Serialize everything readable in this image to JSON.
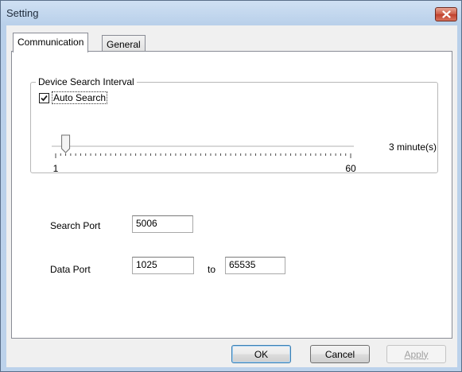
{
  "window": {
    "title": "Setting"
  },
  "tabs": [
    {
      "label": "Communication",
      "active": true
    },
    {
      "label": "General",
      "active": false
    }
  ],
  "device_search": {
    "group_label": "Device Search Interval",
    "auto_search_label": "Auto Search",
    "auto_search_checked": true,
    "slider": {
      "min_label": "1",
      "max_label": "60",
      "min": 1,
      "max": 60,
      "value": 3
    },
    "value_text": "3 minute(s)"
  },
  "search_port": {
    "label": "Search Port",
    "value": "5006"
  },
  "data_port": {
    "label": "Data Port",
    "from_value": "1025",
    "to_label": "to",
    "to_value": "65535"
  },
  "buttons": {
    "ok": "OK",
    "cancel": "Cancel",
    "apply": "Apply",
    "apply_enabled": false
  },
  "colors": {
    "titlebar": "#c4d7ec",
    "close_button": "#c94a36",
    "panel_bg": "#ffffff",
    "dialog_bg": "#f0f0f0"
  }
}
